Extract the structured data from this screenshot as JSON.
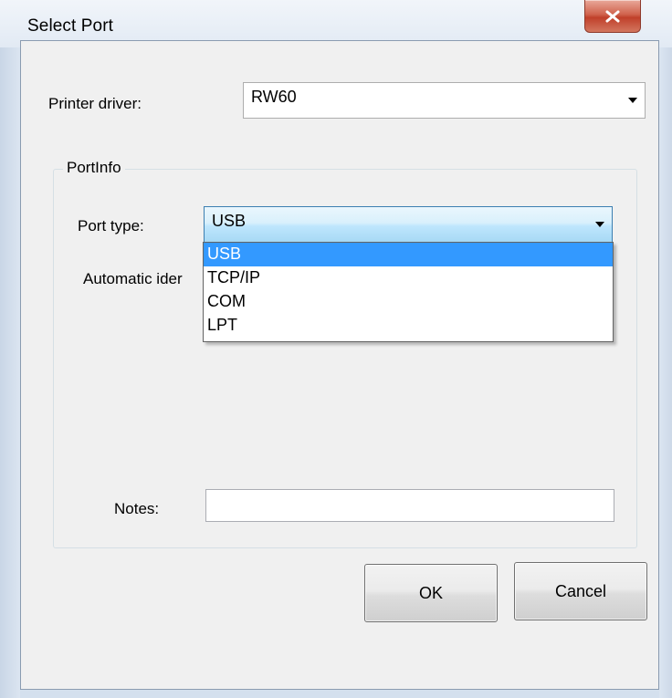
{
  "window": {
    "title": "Select Port",
    "close_icon": "close-icon"
  },
  "printer_driver": {
    "label": "Printer driver:",
    "value": "RW60"
  },
  "port_info": {
    "legend": "PortInfo",
    "port_type_label": "Port type:",
    "port_type_value": "USB",
    "port_type_options": [
      "USB",
      "TCP/IP",
      "COM",
      "LPT"
    ],
    "automatic_label": "Automatic ider",
    "notes_label": "Notes:",
    "notes_value": ""
  },
  "buttons": {
    "ok": "OK",
    "cancel": "Cancel"
  },
  "colors": {
    "selection": "#3399ff",
    "close_button": "#c0402a"
  }
}
